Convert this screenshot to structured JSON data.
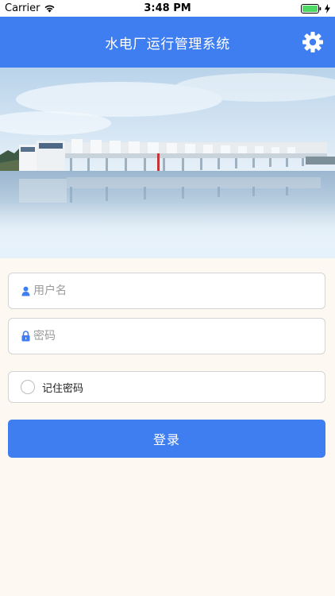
{
  "status_bar": {
    "carrier": "Carrier",
    "time": "3:48 PM"
  },
  "header": {
    "title": "水电厂运行管理系统",
    "settings_icon": "gear-icon"
  },
  "banner": {
    "image": "dam-reservoir-photo"
  },
  "form": {
    "username": {
      "placeholder": "用户名",
      "value": "",
      "icon": "user-icon"
    },
    "password": {
      "placeholder": "密码",
      "value": "",
      "icon": "lock-icon"
    },
    "remember_label": "记住密码",
    "remember_checked": false,
    "login_label": "登录"
  },
  "colors": {
    "primary": "#3f7ef0",
    "page_background": "#fdf8f1"
  }
}
